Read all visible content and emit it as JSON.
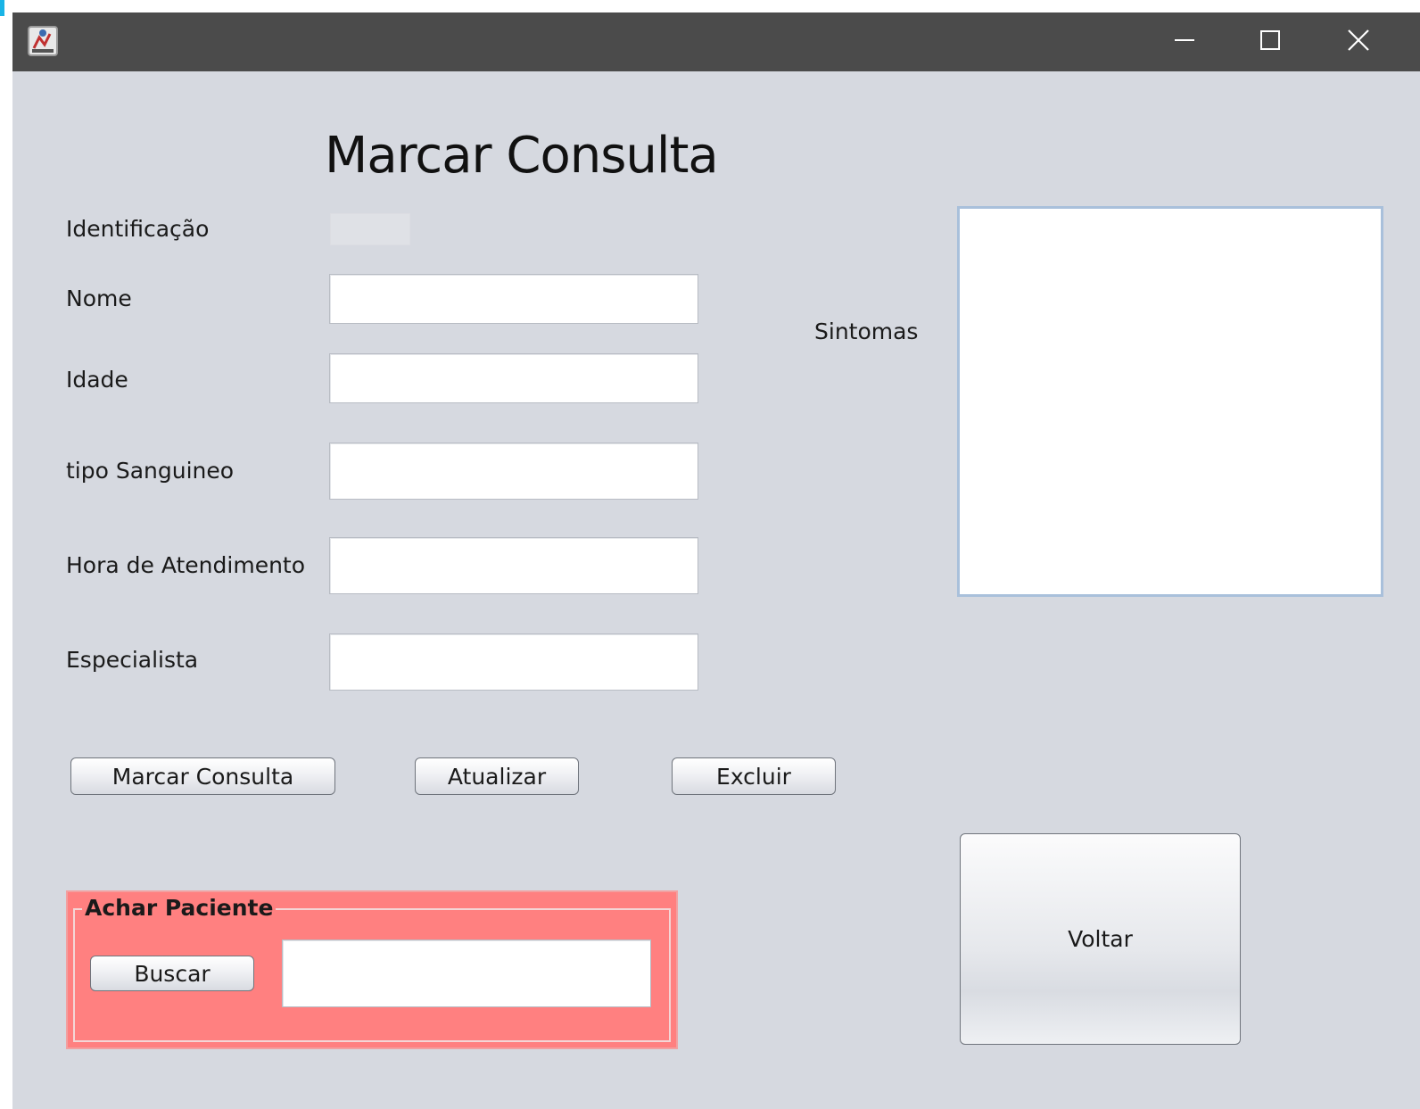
{
  "window": {
    "controls": {
      "minimize_icon": "minimize-icon",
      "maximize_icon": "maximize-icon",
      "close_icon": "close-icon"
    }
  },
  "form": {
    "title": "Marcar Consulta",
    "fields": {
      "identificacao": {
        "label": "Identificação",
        "value": ""
      },
      "nome": {
        "label": "Nome",
        "value": ""
      },
      "idade": {
        "label": "Idade",
        "value": ""
      },
      "tipo_sanguineo": {
        "label": "tipo Sanguineo",
        "value": ""
      },
      "hora_atendimento": {
        "label": "Hora de Atendimento",
        "value": ""
      },
      "especialista": {
        "label": "Especialista",
        "value": ""
      }
    },
    "sintomas": {
      "label": "Sintomas",
      "value": ""
    }
  },
  "buttons": {
    "marcar": "Marcar Consulta",
    "atualizar": "Atualizar",
    "excluir": "Excluir",
    "voltar": "Voltar"
  },
  "search": {
    "title": "Achar Paciente",
    "button": "Buscar",
    "value": ""
  },
  "colors": {
    "titlebar": "#4b4b4b",
    "background": "#d6d9e0",
    "search_panel": "#ff8080"
  }
}
